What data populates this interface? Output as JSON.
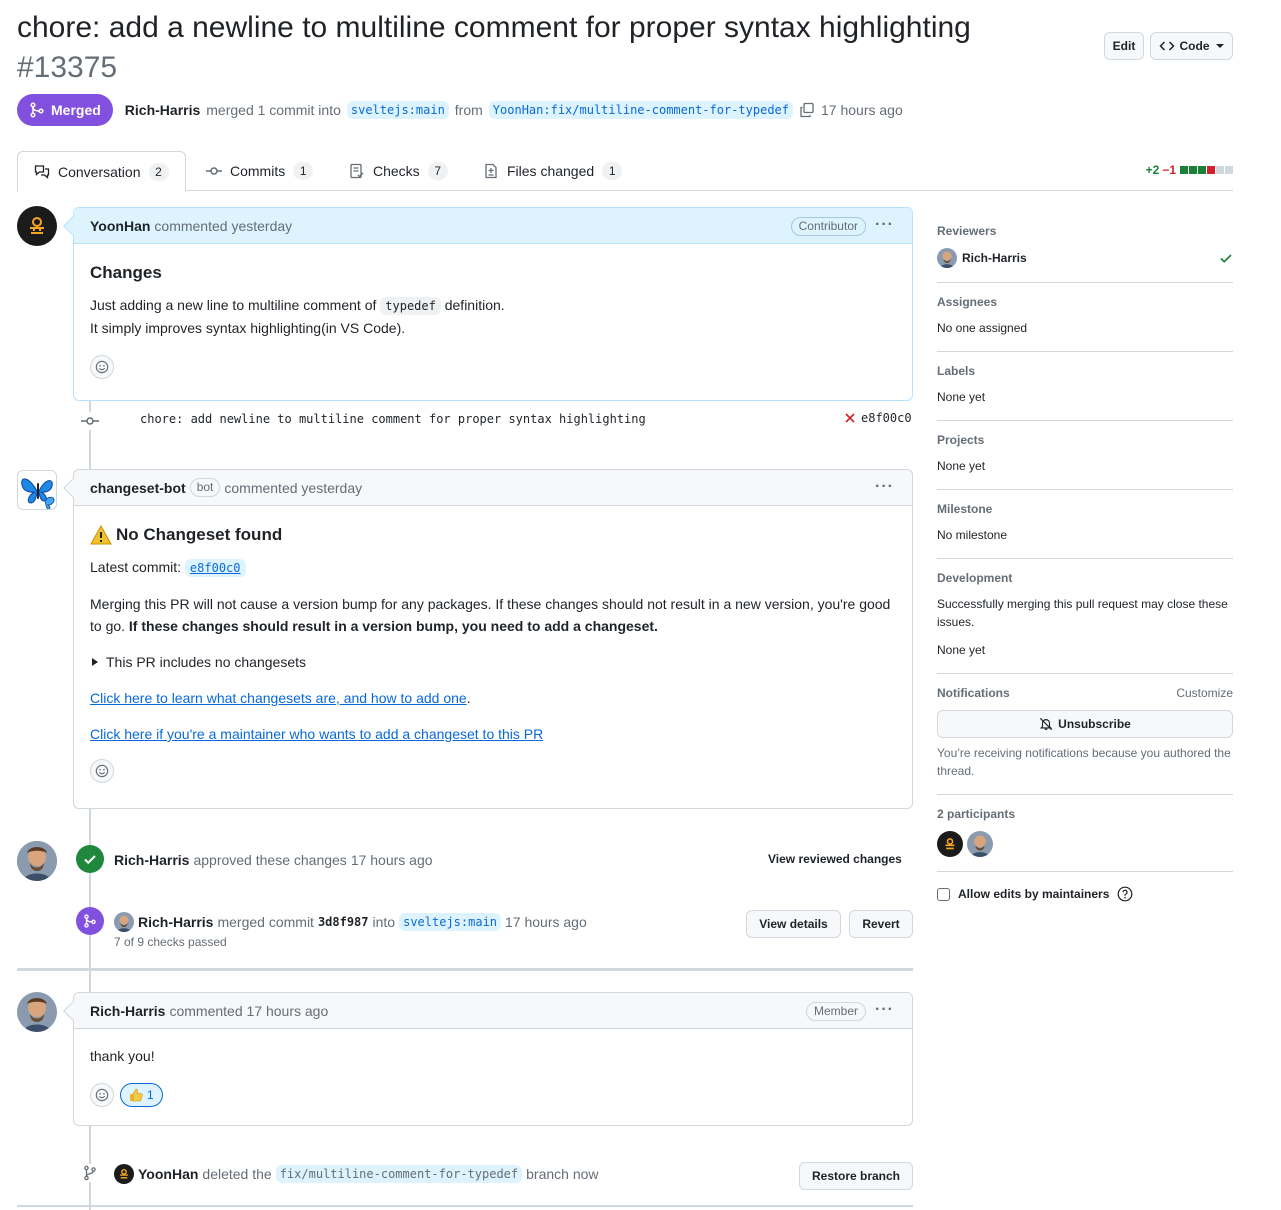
{
  "header": {
    "title": "chore: add a newline to multiline comment for proper syntax highlighting",
    "number": "#13375",
    "edit_label": "Edit",
    "code_label": "Code"
  },
  "state": {
    "badge": "Merged",
    "author": "Rich-Harris",
    "merged_text": "merged 1 commit into",
    "base_branch": "sveltejs:main",
    "from_text": "from",
    "head_branch": "YoonHan:fix/multiline-comment-for-typedef",
    "time": "17 hours ago"
  },
  "tabs": [
    {
      "label": "Conversation",
      "count": "2"
    },
    {
      "label": "Commits",
      "count": "1"
    },
    {
      "label": "Checks",
      "count": "7"
    },
    {
      "label": "Files changed",
      "count": "1"
    }
  ],
  "diffstat": {
    "additions": "+2",
    "deletions": "−1",
    "colors": [
      "#1a7f37",
      "#1a7f37",
      "#1a7f37",
      "#cf222e",
      "#d0d7de",
      "#d0d7de"
    ]
  },
  "comment1": {
    "author": "YoonHan",
    "meta": "commented yesterday",
    "role": "Contributor",
    "heading": "Changes",
    "p1_before": "Just adding a new line to multiline comment of",
    "p1_code": "typedef",
    "p1_after": "definition.",
    "p2": "It simply improves syntax highlighting(in VS Code)."
  },
  "commit": {
    "message": "chore: add newline to multiline comment for proper syntax highlighting",
    "sha": "e8f00c0"
  },
  "comment2": {
    "author": "changeset-bot",
    "bot_label": "bot",
    "meta": "commented yesterday",
    "heading": "No Changeset found",
    "latest_label": "Latest commit:",
    "latest_sha": "e8f00c0",
    "para": "Merging this PR will not cause a version bump for any packages. If these changes should not result in a new version, you're good to go.",
    "para_bold": "If these changes should result in a version bump, you need to add a changeset.",
    "details": "This PR includes no changesets",
    "link1": "Click here to learn what changesets are, and how to add one",
    "link2": "Click here if you're a maintainer who wants to add a changeset to this PR"
  },
  "approval": {
    "author": "Rich-Harris",
    "text": "approved these changes",
    "time": "17 hours ago",
    "view": "View reviewed changes"
  },
  "merge_event": {
    "author": "Rich-Harris",
    "text": "merged commit",
    "sha": "3d8f987",
    "into": "into",
    "branch": "sveltejs:main",
    "time": "17 hours ago",
    "checks": "7 of 9 checks passed",
    "view_details": "View details",
    "revert": "Revert"
  },
  "comment3": {
    "author": "Rich-Harris",
    "meta": "commented 17 hours ago",
    "role": "Member",
    "body": "thank you!",
    "reaction_count": "1"
  },
  "delete_event": {
    "author": "YoonHan",
    "text": "deleted the",
    "branch": "fix/multiline-comment-for-typedef",
    "after": "branch now",
    "restore": "Restore branch"
  },
  "sidebar": {
    "reviewers_h": "Reviewers",
    "reviewer": "Rich-Harris",
    "assignees_h": "Assignees",
    "assignees": "No one assigned",
    "labels_h": "Labels",
    "labels": "None yet",
    "projects_h": "Projects",
    "projects": "None yet",
    "milestone_h": "Milestone",
    "milestone": "No milestone",
    "development_h": "Development",
    "development": "Successfully merging this pull request may close these issues.",
    "development_none": "None yet",
    "notifications_h": "Notifications",
    "customize": "Customize",
    "unsubscribe": "Unsubscribe",
    "notif_reason": "You’re receiving notifications because you authored the thread.",
    "participants_h": "2 participants",
    "allow_edits": "Allow edits by maintainers"
  }
}
